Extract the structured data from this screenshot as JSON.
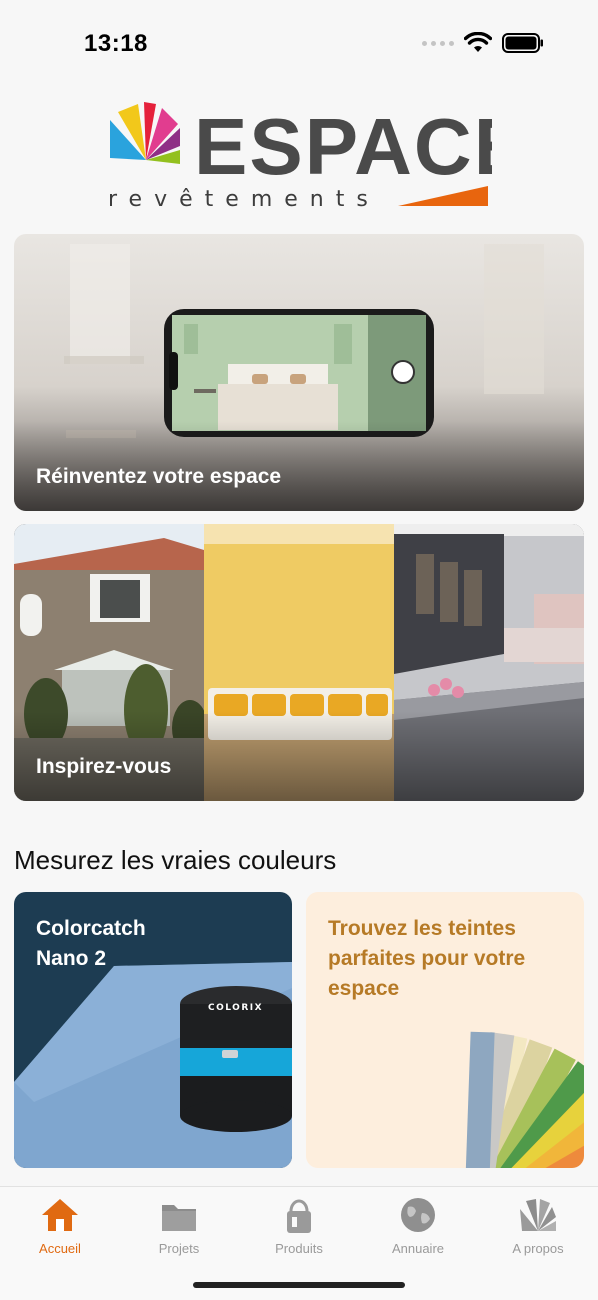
{
  "status_bar": {
    "time": "13:18"
  },
  "logo": {
    "word": "ESPACE",
    "tagline": "revêtements"
  },
  "cards": {
    "ar": {
      "caption": "Réinventez votre espace"
    },
    "inspire": {
      "caption": "Inspirez-vous"
    }
  },
  "section": {
    "title": "Mesurez les vraies couleurs"
  },
  "colorcatch": {
    "title_line1": "Colorcatch",
    "title_line2": "Nano 2",
    "device_brand": "COLORIX"
  },
  "teintes": {
    "title": "Trouvez les teintes parfaites pour votre espace"
  },
  "tabs": [
    {
      "label": "Accueil",
      "icon": "home-icon",
      "active": true
    },
    {
      "label": "Projets",
      "icon": "folder-icon",
      "active": false
    },
    {
      "label": "Produits",
      "icon": "paint-bucket-icon",
      "active": false
    },
    {
      "label": "Annuaire",
      "icon": "globe-icon",
      "active": false
    },
    {
      "label": "A propos",
      "icon": "logo-fan-icon",
      "active": false
    }
  ],
  "colors": {
    "accent": "#e06a12",
    "teintes_text": "#b67a26",
    "colorcatch_bg": "#1d3c52",
    "teintes_bg": "#fdeedd",
    "logo_grey": "#4a4a4a"
  }
}
